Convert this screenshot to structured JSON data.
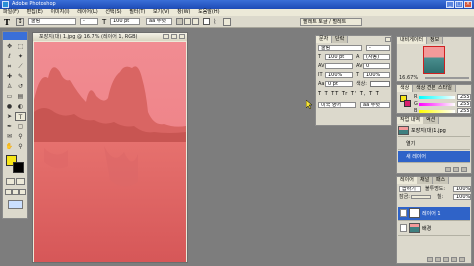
{
  "app": {
    "title": "Adobe Photoshop"
  },
  "window_buttons": {
    "minimize": "_",
    "maximize": "□",
    "close": "×"
  },
  "menu": [
    "파일(F)",
    "편집(E)",
    "이미지(I)",
    "레이어(L)",
    "선택(S)",
    "필터(T)",
    "보기(V)",
    "창(W)",
    "도움말(H)"
  ],
  "options": {
    "font": "굴림",
    "style": "-",
    "size": "100 pt",
    "aa": "aa 뚜렷",
    "palettes_button": "팔레트 토글 / 펄레트"
  },
  "document": {
    "title": "포장지(대) 1.jpg @ 16.7% (레이어 1, RGB)"
  },
  "character_panel": {
    "tabs": [
      "문자",
      "단락"
    ],
    "font": "굴림",
    "style": "-",
    "size": "100 pt",
    "leading": "(자동)",
    "tracking": "0",
    "vscale": "100%",
    "hscale": "100%",
    "baseline": "0 pt",
    "color_label": "색상:",
    "language": "미국 영어",
    "aa": "aa 뚜렷"
  },
  "navigator": {
    "tabs": [
      "내비게이터",
      "정보"
    ],
    "zoom": "16.67%"
  },
  "color_panel": {
    "tabs": [
      "색상",
      "색상 견본",
      "스타일"
    ],
    "r_label": "R",
    "g_label": "G",
    "b_label": "B",
    "r": "255",
    "g": "255",
    "b": "255",
    "fg_color": "#f7e617",
    "bg_color": "#d8206f"
  },
  "history": {
    "tabs": [
      "작업 내역",
      "액션"
    ],
    "items": [
      {
        "label": "포장지(대)1.jpg"
      },
      {
        "label": "열기"
      },
      {
        "label": "새 레이어"
      }
    ]
  },
  "layers": {
    "tabs": [
      "레이어",
      "채널",
      "패스"
    ],
    "mode": "곱하기",
    "opacity_label": "불투명도:",
    "opacity": "100%",
    "lock_label": "잠금:",
    "fill_label": "칠:",
    "fill": "100%",
    "items": [
      {
        "label": "레이어 1",
        "selected": true
      },
      {
        "label": "배경",
        "selected": false
      }
    ]
  },
  "toolbox": {
    "tools": [
      "move-tool",
      "marquee-tool",
      "lasso-tool",
      "magic-wand-tool",
      "crop-tool",
      "slice-tool",
      "healing-tool",
      "brush-tool",
      "stamp-tool",
      "history-brush-tool",
      "eraser-tool",
      "gradient-tool",
      "blur-tool",
      "dodge-tool",
      "path-tool",
      "type-tool",
      "pen-tool",
      "shape-tool",
      "notes-tool",
      "eyedropper-tool",
      "hand-tool",
      "zoom-tool"
    ],
    "fg_color": "#f7e617",
    "bg_color": "#000000"
  }
}
